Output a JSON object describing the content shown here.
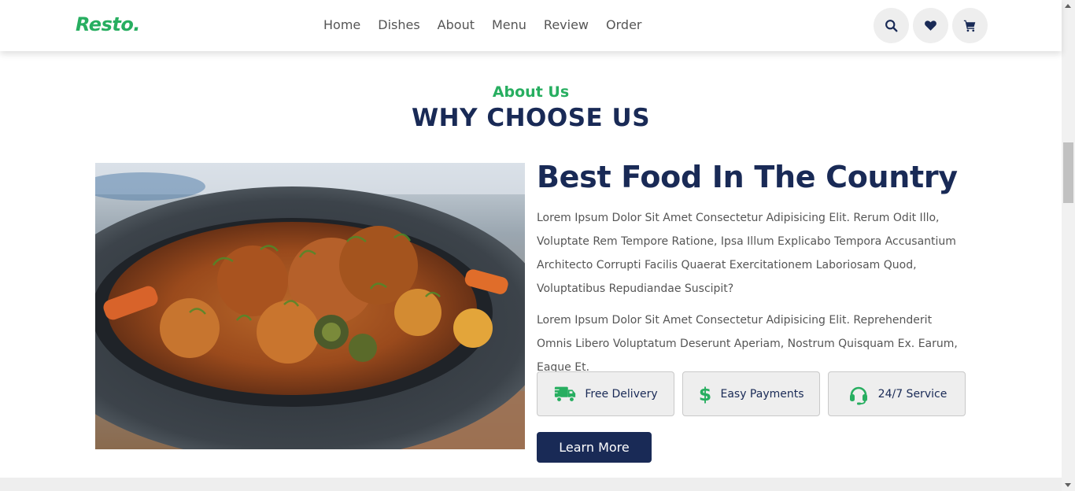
{
  "header": {
    "logo": "Resto.",
    "nav": [
      "Home",
      "Dishes",
      "About",
      "Menu",
      "Review",
      "Order"
    ],
    "icons": [
      "search-icon",
      "heart-icon",
      "cart-icon"
    ]
  },
  "about": {
    "sub_heading": "About Us",
    "heading": "WHY CHOOSE US",
    "title": "Best Food In The Country",
    "paragraph1": "Lorem Ipsum Dolor Sit Amet Consectetur Adipisicing Elit. Rerum Odit Illo, Voluptate Rem Tempore Ratione, Ipsa Illum Explicabo Tempora Accusantium Architecto Corrupti Facilis Quaerat Exercitationem Laboriosam Quod, Voluptatibus Repudiandae Suscipit?",
    "paragraph2": "Lorem Ipsum Dolor Sit Amet Consectetur Adipisicing Elit. Reprehenderit Omnis Libero Voluptatum Deserunt Aperiam, Nostrum Quisquam Ex. Earum, Eaque Et.",
    "features": [
      {
        "label": "Free Delivery",
        "icon": "truck-icon"
      },
      {
        "label": "Easy Payments",
        "icon": "dollar-icon"
      },
      {
        "label": "24/7 Service",
        "icon": "headset-icon"
      }
    ],
    "button": "Learn More"
  },
  "colors": {
    "accent_green": "#27ae60",
    "navy": "#192a56",
    "text_gray": "#555555",
    "light_bg": "#eeeeee"
  }
}
